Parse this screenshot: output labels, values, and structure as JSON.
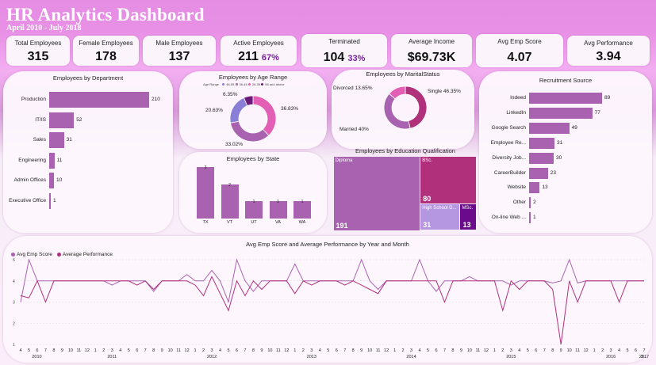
{
  "header": {
    "title": "HR  Analytics Dashboard",
    "subtitle": "April 2010 - July 2018"
  },
  "kpis": {
    "total": {
      "label": "Total Employees",
      "value": "315"
    },
    "female": {
      "label": "Female Employees",
      "value": "178"
    },
    "male": {
      "label": "Male Employees",
      "value": "137"
    },
    "active": {
      "label": "Active Employees",
      "value": "211",
      "pct": "67%"
    },
    "terminated": {
      "label": "Terminated",
      "value": "104",
      "pct": "33%"
    },
    "income": {
      "label": "Average Income",
      "value": "$69.73K"
    },
    "score": {
      "label": "Avg Emp Score",
      "value": "4.07"
    },
    "perf": {
      "label": "Avg Performance",
      "value": "3.94"
    }
  },
  "colors": {
    "bar": "#a862b0",
    "accent": "#7a1f9e",
    "pink": "#e25fb5",
    "magenta": "#b0307c"
  },
  "charts": {
    "department": {
      "title": "Employees by Department",
      "chart_data": {
        "type": "bar",
        "orientation": "horizontal",
        "categories": [
          "Production",
          "IT/IS",
          "Sales",
          "Engineering",
          "Admin Offices",
          "Executive Office"
        ],
        "values": [
          210,
          52,
          31,
          11,
          10,
          1
        ]
      }
    },
    "age": {
      "title": "Employees by Age Range",
      "legend_title": "Age Range",
      "legend": [
        "46-55",
        "36-45",
        "26-35",
        "56 and above"
      ],
      "chart_data": {
        "type": "pie",
        "variant": "donut",
        "categories": [
          "26-35",
          "36-45",
          "46-55",
          "56 and above"
        ],
        "values": [
          36.83,
          33.02,
          20.63,
          6.35
        ],
        "colors": [
          "#e25fb5",
          "#a862b0",
          "#8a7fd6",
          "#6b1a7a"
        ],
        "labels": [
          "36.83%",
          "33.02%",
          "20.63%",
          "6.35%"
        ]
      }
    },
    "marital": {
      "title": "Employees by MaritalStatus",
      "chart_data": {
        "type": "pie",
        "variant": "donut",
        "categories": [
          "Single",
          "Married",
          "Divorced"
        ],
        "values": [
          46.35,
          40,
          13.65
        ],
        "colors": [
          "#b0307c",
          "#a862b0",
          "#e25fb5"
        ],
        "labels": [
          "Single 46.35%",
          "Married 40%",
          "Divorced 13.65%"
        ]
      }
    },
    "recruit": {
      "title": "Recruitment Source",
      "chart_data": {
        "type": "bar",
        "orientation": "horizontal",
        "categories": [
          "Indeed",
          "LinkedIn",
          "Google Search",
          "Employee Re...",
          "Diversity Job...",
          "CareerBuilder",
          "Website",
          "Other",
          "On-line Web ..."
        ],
        "values": [
          89,
          77,
          49,
          31,
          30,
          23,
          13,
          2,
          1
        ]
      }
    },
    "state": {
      "title": "Employees by State",
      "chart_data": {
        "type": "bar",
        "categories": [
          "TX",
          "VT",
          "UT",
          "VA",
          "WA"
        ],
        "values": [
          3,
          2,
          1,
          1,
          1
        ],
        "labels": [
          "3",
          "2",
          "1",
          "1",
          "1"
        ]
      }
    },
    "education": {
      "title": "Employees by Education Qualification",
      "chart_data": {
        "type": "treemap",
        "categories": [
          "Diploma",
          "BSc.",
          "High School D...",
          "MSc."
        ],
        "values": [
          191,
          80,
          31,
          13
        ],
        "colors": [
          "#a862b0",
          "#b0307c",
          "#b497e0",
          "#6b0a8a"
        ]
      }
    },
    "trend": {
      "title": "Avg Emp Score and Average Performance by Year and Month",
      "legend": [
        "Avg Emp Score",
        "Average Performance"
      ],
      "year_labels": [
        "2010",
        "2011",
        "2012",
        "2013",
        "2014",
        "2015",
        "2016",
        "2017",
        "2..."
      ],
      "chart_data": {
        "type": "line",
        "ylim": [
          1,
          5
        ],
        "yticks": [
          "1",
          "2",
          "3",
          "4",
          "5"
        ],
        "x": [
          "4",
          "5",
          "6",
          "7",
          "8",
          "9",
          "10",
          "11",
          "12",
          "1",
          "2",
          "3",
          "4",
          "5",
          "6",
          "7",
          "8",
          "9",
          "10",
          "11",
          "12",
          "1",
          "2",
          "3",
          "4",
          "5",
          "6",
          "7",
          "8",
          "9",
          "10",
          "11",
          "12",
          "1",
          "2",
          "3",
          "4",
          "5",
          "6",
          "7",
          "8",
          "9",
          "10",
          "11",
          "12",
          "1",
          "2",
          "3",
          "4",
          "5",
          "6",
          "7",
          "8",
          "9",
          "10",
          "11",
          "12",
          "1",
          "2",
          "3",
          "4",
          "5",
          "6",
          "7",
          "8",
          "9",
          "10",
          "11",
          "12",
          "1",
          "2",
          "3",
          "4",
          "5",
          "6",
          "7"
        ],
        "series": [
          {
            "name": "Avg Emp Score",
            "color": "#a862b0",
            "values": [
              3.0,
              5.0,
              4.0,
              4.0,
              4.0,
              4.0,
              4.0,
              4.0,
              4.0,
              4.0,
              4.0,
              3.8,
              4.0,
              4.0,
              4.0,
              4.0,
              3.5,
              4.0,
              4.0,
              4.0,
              4.3,
              4.0,
              4.0,
              4.5,
              4.0,
              3.0,
              5.0,
              4.0,
              3.5,
              4.0,
              4.0,
              4.0,
              4.0,
              4.8,
              4.0,
              4.0,
              4.0,
              4.0,
              4.0,
              4.0,
              4.0,
              5.0,
              4.0,
              3.6,
              4.0,
              4.0,
              4.0,
              4.0,
              5.0,
              4.0,
              3.5,
              4.0,
              4.0,
              4.0,
              4.2,
              4.0,
              4.0,
              4.0,
              4.0,
              3.8,
              4.0,
              4.0,
              4.0,
              4.0,
              3.9,
              4.0,
              5.0,
              3.9,
              4.0,
              4.0,
              4.0,
              4.0,
              4.0,
              4.0,
              4.0,
              4.0
            ]
          },
          {
            "name": "Average Performance",
            "color": "#b0307c",
            "values": [
              3.3,
              3.2,
              4.0,
              3.0,
              4.0,
              4.0,
              4.0,
              4.0,
              4.0,
              4.0,
              4.0,
              4.0,
              4.0,
              4.0,
              3.8,
              4.0,
              3.6,
              4.0,
              4.0,
              4.0,
              4.0,
              3.8,
              3.3,
              4.2,
              3.4,
              2.6,
              4.0,
              3.3,
              4.0,
              3.6,
              4.0,
              4.0,
              4.0,
              3.4,
              4.0,
              3.8,
              4.0,
              4.0,
              4.0,
              3.8,
              4.0,
              3.8,
              3.6,
              3.4,
              4.0,
              4.0,
              4.0,
              4.0,
              4.0,
              4.0,
              4.0,
              3.0,
              4.0,
              4.0,
              4.0,
              4.0,
              4.0,
              4.0,
              2.6,
              4.0,
              3.6,
              4.0,
              4.0,
              4.0,
              3.6,
              1.0,
              4.0,
              3.0,
              4.0,
              4.0,
              4.0,
              4.0,
              3.0,
              4.0,
              4.0,
              4.0
            ]
          }
        ]
      }
    }
  }
}
